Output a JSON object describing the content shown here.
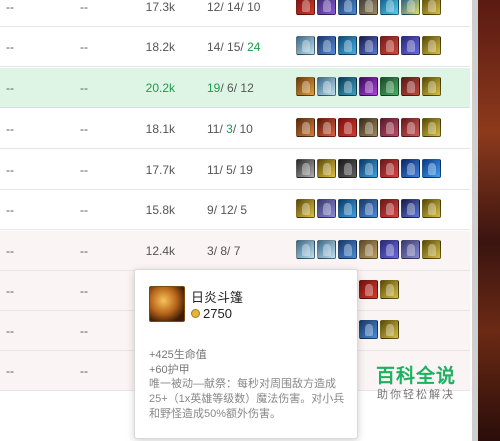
{
  "rows": [
    {
      "c1": "--",
      "c2": "--",
      "dmg": "17.3k",
      "k": "12",
      "d": "14",
      "a": "10",
      "k_g": false,
      "d_g": false,
      "a_g": false,
      "items": [
        [
          "#7a1010",
          "#d23a2a"
        ],
        [
          "#3a2a6a",
          "#8a5ad8"
        ],
        [
          "#1a3a6a",
          "#4a8ad8"
        ],
        [
          "#3a3a3a",
          "#a08a5a"
        ],
        [
          "#0a5a8a",
          "#5ad0f0"
        ],
        [
          "#1a5a8a",
          "#e0e060"
        ],
        [
          "#5a4a0a",
          "#d8c040"
        ]
      ]
    },
    {
      "c1": "--",
      "c2": "--",
      "dmg": "18.2k",
      "k": "14",
      "d": "15",
      "a": "24",
      "k_g": false,
      "d_g": false,
      "a_g": true,
      "items": [
        [
          "#3a6a8a",
          "#c0e0f0"
        ],
        [
          "#1a3a6a",
          "#5a8ad8"
        ],
        [
          "#0a4a7a",
          "#4ab0e0"
        ],
        [
          "#1a1a4a",
          "#5a7ad8"
        ],
        [
          "#7a1a1a",
          "#d04a3a"
        ],
        [
          "#2a2a7a",
          "#6a6ae0"
        ],
        [
          "#5a4a0a",
          "#d8c040"
        ]
      ]
    },
    {
      "c1": "--",
      "c2": "--",
      "dmg": "20.2k",
      "k": "19",
      "d": "6",
      "a": "12",
      "k_g": true,
      "d_g": false,
      "a_g": false,
      "items": [
        [
          "#6a3a0a",
          "#e0a040"
        ],
        [
          "#3a6a8a",
          "#c0e0f0"
        ],
        [
          "#0a3a5a",
          "#40a0c0"
        ],
        [
          "#3a0a5a",
          "#b040e0"
        ],
        [
          "#1a4a2a",
          "#4ab060"
        ],
        [
          "#5a1a1a",
          "#c04a3a"
        ],
        [
          "#5a4a0a",
          "#d8c040"
        ]
      ]
    },
    {
      "c1": "--",
      "c2": "--",
      "dmg": "18.1k",
      "k": "11",
      "d": "3",
      "a": "10",
      "k_g": false,
      "d_g": true,
      "a_g": false,
      "items": [
        [
          "#5a2a0a",
          "#d08040"
        ],
        [
          "#5a1a0a",
          "#e06040"
        ],
        [
          "#7a1010",
          "#d23a2a"
        ],
        [
          "#3a2a1a",
          "#a08a5a"
        ],
        [
          "#5a1a2a",
          "#c04a6a"
        ],
        [
          "#6a1a1a",
          "#d05a5a"
        ],
        [
          "#5a4a0a",
          "#d8c040"
        ]
      ]
    },
    {
      "c1": "--",
      "c2": "--",
      "dmg": "17.7k",
      "k": "11",
      "d": "5",
      "a": "19",
      "k_g": false,
      "d_g": false,
      "a_g": false,
      "items": [
        [
          "#2a2a2a",
          "#b0b0b0"
        ],
        [
          "#5a4a0a",
          "#e0c040"
        ],
        [
          "#1a1a1a",
          "#606060"
        ],
        [
          "#0a3a6a",
          "#40a0e0"
        ],
        [
          "#6a1a1a",
          "#e04040"
        ],
        [
          "#0a2a6a",
          "#4080e0"
        ],
        [
          "#0a3a8a",
          "#40a0f0"
        ]
      ]
    },
    {
      "c1": "--",
      "c2": "--",
      "dmg": "15.8k",
      "k": "9",
      "d": "12",
      "a": "5",
      "k_g": false,
      "d_g": false,
      "a_g": false,
      "items": [
        [
          "#5a4a0a",
          "#e0c040"
        ],
        [
          "#3a3a6a",
          "#8a8ad8"
        ],
        [
          "#0a3a6a",
          "#40a0e0"
        ],
        [
          "#1a3a6a",
          "#4a8ad8"
        ],
        [
          "#6a1a1a",
          "#e04040"
        ],
        [
          "#1a1a4a",
          "#5a7ad8"
        ],
        [
          "#5a4a0a",
          "#d8c040"
        ]
      ]
    },
    {
      "c1": "--",
      "c2": "--",
      "dmg": "12.4k",
      "k": "3",
      "d": "8",
      "a": "7",
      "k_g": false,
      "d_g": false,
      "a_g": false,
      "items": [
        [
          "#3a6a8a",
          "#c0e0f0"
        ],
        [
          "#3a6a8a",
          "#c0e0f0"
        ],
        [
          "#1a3a6a",
          "#4a8ad8"
        ],
        [
          "#5a4a2a",
          "#c0a060"
        ],
        [
          "#2a2a7a",
          "#6a6ae0"
        ],
        [
          "#3a3a6a",
          "#8a8ad8"
        ],
        [
          "#5a4a0a",
          "#d8c040"
        ]
      ]
    },
    {
      "c1": "--",
      "c2": "--",
      "dmg": "",
      "k": "",
      "d": "",
      "a": "",
      "k_g": false,
      "d_g": false,
      "a_g": false,
      "items": [
        [
          "#6a3a0a",
          "#e0a040"
        ],
        [
          "#5a1a0a",
          "#e06040"
        ],
        [
          "#5a1a1a",
          "#c04a3a"
        ],
        [
          "#7a1010",
          "#d23a2a"
        ],
        [
          "#5a4a0a",
          "#d8c040"
        ]
      ]
    },
    {
      "c1": "--",
      "c2": "--",
      "dmg": "",
      "k": "",
      "d": "",
      "a": "",
      "k_g": false,
      "d_g": false,
      "a_g": false,
      "items": [
        [
          "#2a2a2a",
          "#b0b0b0"
        ],
        [
          "#3a6a8a",
          "#c0e0f0"
        ],
        [
          "#5a4a0a",
          "#d8c040"
        ],
        [
          "#1a3a6a",
          "#4a8ad8"
        ],
        [
          "#5a4a0a",
          "#d8c040"
        ]
      ]
    },
    {
      "c1": "--",
      "c2": "--",
      "dmg": "",
      "k": "",
      "d": "",
      "a": "",
      "k_g": false,
      "d_g": false,
      "a_g": false,
      "items": []
    }
  ],
  "tooltip": {
    "name": "日炎斗篷",
    "cost": "2750",
    "stat1": "+425生命值",
    "stat2": "+60护甲",
    "desc": "唯一被动—献祭：每秒对周围敌方造成25+（1x英雄等级数）魔法伤害。对小兵和野怪造成50%额外伤害。",
    "icon": "sunfire-cape-icon"
  },
  "watermark": {
    "title": "百科全说",
    "subtitle": "助你轻松解决"
  }
}
